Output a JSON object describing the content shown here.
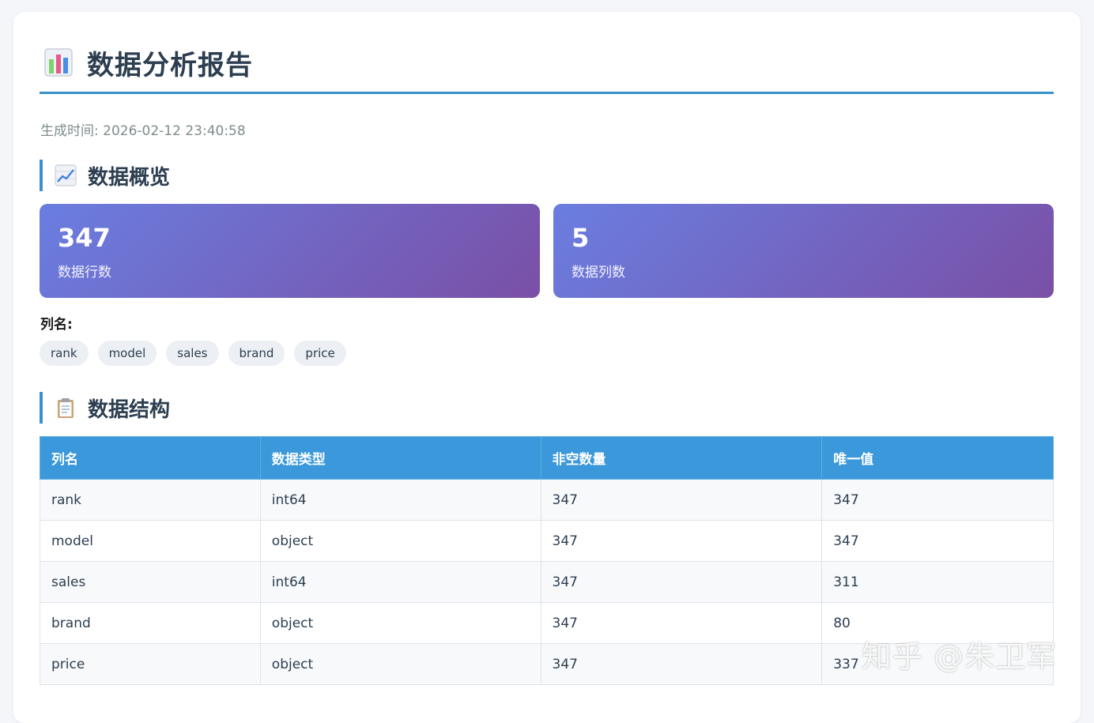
{
  "header": {
    "title": "数据分析报告",
    "title_icon": "bar-chart-icon",
    "timestamp": "生成时间: 2026-02-12 23:40:58"
  },
  "overview": {
    "heading": "数据概览",
    "heading_icon": "trend-chart-icon",
    "stats": [
      {
        "value": "347",
        "label": "数据行数"
      },
      {
        "value": "5",
        "label": "数据列数"
      }
    ],
    "columns_label": "列名:",
    "columns": [
      "rank",
      "model",
      "sales",
      "brand",
      "price"
    ]
  },
  "structure": {
    "heading": "数据结构",
    "heading_icon": "clipboard-icon",
    "headers": [
      "列名",
      "数据类型",
      "非空数量",
      "唯一值"
    ],
    "rows": [
      [
        "rank",
        "int64",
        "347",
        "347"
      ],
      [
        "model",
        "object",
        "347",
        "347"
      ],
      [
        "sales",
        "int64",
        "347",
        "311"
      ],
      [
        "brand",
        "object",
        "347",
        "80"
      ],
      [
        "price",
        "object",
        "347",
        "337"
      ]
    ]
  },
  "watermark": "知乎 @朱卫军",
  "colors": {
    "accent": "#3a8fcd",
    "table_header": "#3a98db",
    "gradient_start": "#6a7ee0",
    "gradient_end": "#7a4fa6"
  }
}
